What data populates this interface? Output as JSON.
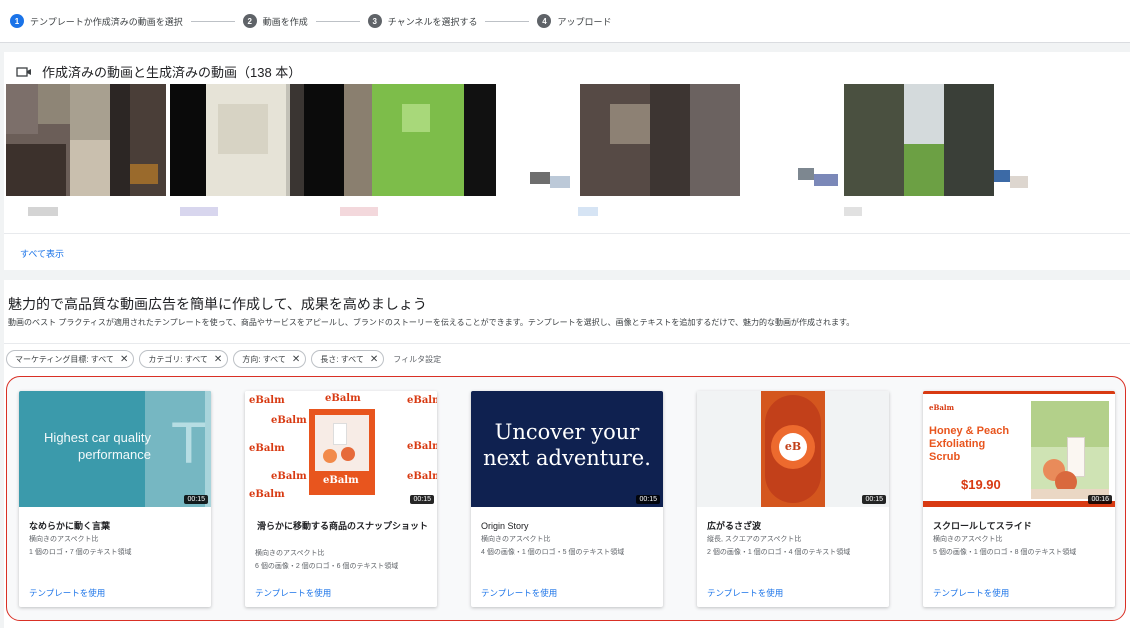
{
  "stepper": {
    "steps": [
      {
        "num": "1",
        "label": "テンプレートか作成済みの動画を選択"
      },
      {
        "num": "2",
        "label": "動画を作成"
      },
      {
        "num": "3",
        "label": "チャンネルを選択する"
      },
      {
        "num": "4",
        "label": "アップロード"
      }
    ]
  },
  "videos": {
    "title": "作成済みの動画と生成済みの動画（138 本）",
    "show_all": "すべて表示"
  },
  "templates": {
    "heading": "魅力的で高品質な動画広告を簡単に作成して、成果を高めましょう",
    "description": "動画のベスト プラクティスが適用されたテンプレートを使って、商品やサービスをアピールし、ブランドのストーリーを伝えることができます。テンプレートを選択し、画像とテキストを追加するだけで、魅力的な動画が作成されます。",
    "filters": [
      {
        "label": "マーケティング目標: すべて"
      },
      {
        "label": "カテゴリ: すべて"
      },
      {
        "label": "方向: すべて"
      },
      {
        "label": "長さ: すべて"
      }
    ],
    "filter_settings": "フィルタ設定",
    "use_label": "テンプレートを使用",
    "cards": [
      {
        "title": "なめらかに動く言葉",
        "aspect": "横向きのアスペクト比",
        "assets": "1 個のロゴ・7 個のテキスト領域",
        "duration": "00:15",
        "preview_text": "Highest car quality performance"
      },
      {
        "title": "滑らかに移動する商品のスナップショット",
        "aspect": "横向きのアスペクト比",
        "assets": "6 個の画像・2 個のロゴ・6 個のテキスト領域",
        "duration": "00:15",
        "brand": "eBalm"
      },
      {
        "title": "Origin Story",
        "aspect": "横向きのアスペクト比",
        "assets": "4 個の画像・1 個のロゴ・5 個のテキスト領域",
        "duration": "00:15",
        "preview_text": "Uncover your next adventure."
      },
      {
        "title": "広がるさざ波",
        "aspect": "縦長, スクエアのアスペクト比",
        "assets": "2 個の画像・1 個のロゴ・4 個のテキスト領域",
        "duration": "00:15",
        "logo": "eB"
      },
      {
        "title": "スクロールしてスライド",
        "aspect": "横向きのアスペクト比",
        "assets": "5 個の画像・1 個のロゴ・8 個のテキスト領域",
        "duration": "00:16",
        "brand": "eBalm",
        "product": "Honey & Peach Exfoliating Scrub",
        "price": "$19.90"
      }
    ]
  },
  "colors": {
    "accent": "#1a73e8",
    "highlight_border": "#d93025",
    "ebalm_red": "#d83a12",
    "navy": "#0f2150",
    "teal": "#3b9aab",
    "orange": "#e8551e"
  }
}
